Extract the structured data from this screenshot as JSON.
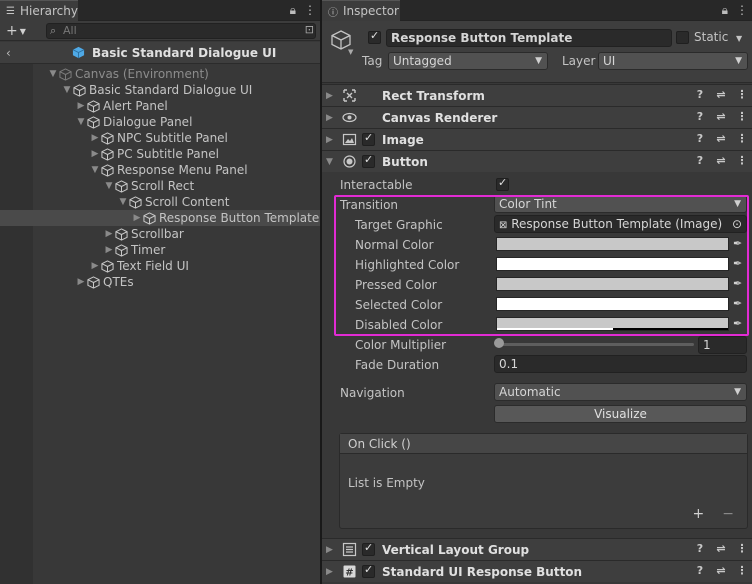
{
  "hierarchy": {
    "tab": "Hierarchy",
    "search_placeholder": "All",
    "scene": "Basic Standard Dialogue UI",
    "rows": [
      {
        "label": "Canvas (Environment)",
        "indent": 0,
        "arrow": "▼",
        "dim": true
      },
      {
        "label": "Basic Standard Dialogue UI",
        "indent": 1,
        "arrow": "▼"
      },
      {
        "label": "Alert Panel",
        "indent": 2,
        "arrow": "▶"
      },
      {
        "label": "Dialogue Panel",
        "indent": 2,
        "arrow": "▼"
      },
      {
        "label": "NPC Subtitle Panel",
        "indent": 3,
        "arrow": "▶"
      },
      {
        "label": "PC Subtitle Panel",
        "indent": 3,
        "arrow": "▶"
      },
      {
        "label": "Response Menu Panel",
        "indent": 3,
        "arrow": "▼"
      },
      {
        "label": "Scroll Rect",
        "indent": 4,
        "arrow": "▼"
      },
      {
        "label": "Scroll Content",
        "indent": 5,
        "arrow": "▼"
      },
      {
        "label": "Response Button Template",
        "indent": 6,
        "arrow": "▶",
        "selected": true
      },
      {
        "label": "Scrollbar",
        "indent": 4,
        "arrow": "▶"
      },
      {
        "label": "Timer",
        "indent": 4,
        "arrow": "▶"
      },
      {
        "label": "Text Field UI",
        "indent": 3,
        "arrow": "▶"
      },
      {
        "label": "QTEs",
        "indent": 2,
        "arrow": "▶"
      }
    ]
  },
  "inspector": {
    "tab": "Inspector",
    "object_name": "Response Button Template",
    "static_label": "Static",
    "tag_label": "Tag",
    "tag_value": "Untagged",
    "layer_label": "Layer",
    "layer_value": "UI",
    "components": {
      "rect": "Rect Transform",
      "canvas": "Canvas Renderer",
      "image": "Image",
      "button": "Button",
      "vlg": "Vertical Layout Group",
      "srb": "Standard UI Response Button"
    },
    "button": {
      "interactable_label": "Interactable",
      "transition_label": "Transition",
      "transition_value": "Color Tint",
      "target_graphic_label": "Target Graphic",
      "target_graphic_value": "Response Button Template (Image)",
      "normal_label": "Normal Color",
      "highlighted_label": "Highlighted Color",
      "pressed_label": "Pressed Color",
      "selected_label": "Selected Color",
      "disabled_label": "Disabled Color",
      "multiplier_label": "Color Multiplier",
      "multiplier_value": "1",
      "fade_label": "Fade Duration",
      "fade_value": "0.1",
      "navigation_label": "Navigation",
      "navigation_value": "Automatic",
      "visualize_label": "Visualize",
      "onclick_label": "On Click ()",
      "list_empty": "List is Empty"
    },
    "colors": {
      "normal": "#c8c8c8",
      "highlighted": "#ffffff",
      "pressed": "#c8c8c8",
      "selected": "#ffffff",
      "disabled": "#c8c8c8",
      "highlight_border": "#e22bd4"
    }
  }
}
